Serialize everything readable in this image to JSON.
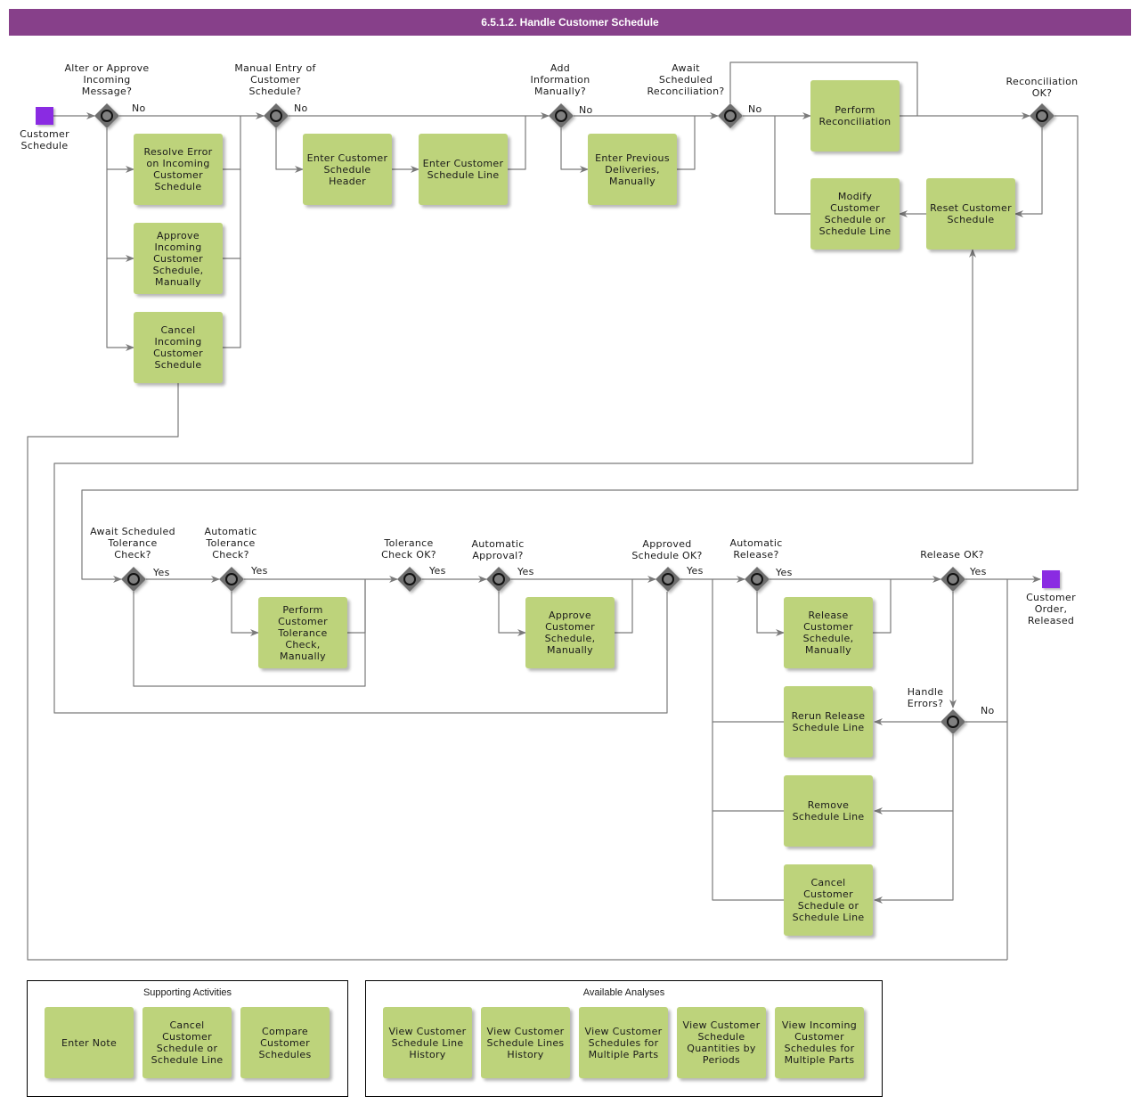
{
  "header": {
    "title": "6.5.1.2. Handle Customer Schedule"
  },
  "colors": {
    "header": "#87408a",
    "task": "#bdd37b",
    "event": "#8a2be2",
    "gateway": "#6e6e6e",
    "line": "#7a7a7a"
  },
  "events": {
    "start": {
      "label": "Customer\nSchedule"
    },
    "end": {
      "label": "Customer\nOrder,\nReleased"
    }
  },
  "gateways": {
    "g1": {
      "label": "Alter or Approve\nIncoming\nMessage?",
      "flow": "No"
    },
    "g2": {
      "label": "Manual Entry of\nCustomer\nSchedule?",
      "flow": "No"
    },
    "g3": {
      "label": "Add\nInformation\nManually?",
      "flow": "No"
    },
    "g4": {
      "label": "Await\nScheduled\nReconciliation?",
      "flow": "No"
    },
    "g5": {
      "label": "Reconciliation\nOK?",
      "flow": ""
    },
    "g6": {
      "label": "Await Scheduled\nTolerance\nCheck?",
      "flow": "Yes"
    },
    "g7": {
      "label": "Automatic\nTolerance\nCheck?",
      "flow": "Yes"
    },
    "g8": {
      "label": "Tolerance\nCheck OK?",
      "flow": "Yes"
    },
    "g9": {
      "label": "Automatic\nApproval?",
      "flow": "Yes"
    },
    "g10": {
      "label": "Approved\nSchedule OK?",
      "flow": "Yes"
    },
    "g11": {
      "label": "Automatic\nRelease?",
      "flow": "Yes"
    },
    "g12": {
      "label": "Release OK?",
      "flow": "Yes"
    },
    "g13": {
      "label": "Handle\nErrors?",
      "flow": "No"
    }
  },
  "tasks": {
    "resolve_error": "Resolve Error on Incoming Customer Schedule",
    "approve_incoming": "Approve Incoming Customer Schedule, Manually",
    "cancel_incoming": "Cancel Incoming Customer Schedule",
    "enter_header": "Enter Customer Schedule Header",
    "enter_line": "Enter Customer Schedule Line",
    "enter_prev_deliveries": "Enter Previous Deliveries, Manually",
    "perform_reconciliation": "Perform Reconciliation",
    "modify_schedule": "Modify Customer Schedule or Schedule Line",
    "reset_schedule": "Reset Customer Schedule",
    "perform_tolerance": "Perform Customer Tolerance Check, Manually",
    "approve_schedule": "Approve Customer Schedule, Manually",
    "release_schedule": "Release Customer Schedule, Manually",
    "rerun_release": "Rerun Release Schedule Line",
    "remove_line": "Remove Schedule Line",
    "cancel_schedule": "Cancel Customer Schedule or Schedule Line"
  },
  "supporting_activities": {
    "title": "Supporting Activities",
    "items": [
      "Enter Note",
      "Cancel Customer Schedule or Schedule Line",
      "Compare Customer Schedules"
    ]
  },
  "available_analyses": {
    "title": "Available Analyses",
    "items": [
      "View Customer Schedule Line History",
      "View Customer Schedule Lines History",
      "View Customer Schedules for Multiple Parts",
      "View Customer Schedule Quantities by Periods",
      "View Incoming Customer Schedules for Multiple Parts"
    ]
  }
}
